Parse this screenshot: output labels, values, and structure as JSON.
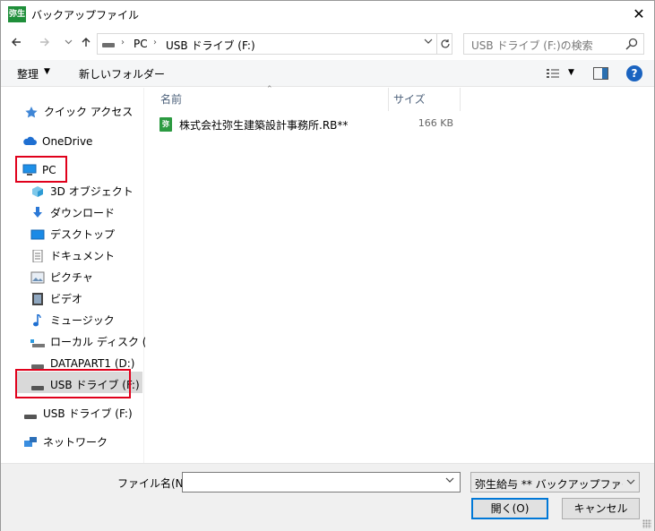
{
  "window": {
    "title": "バックアップファイル",
    "app_icon_text": "弥生",
    "close_glyph": "✕"
  },
  "address": {
    "segments": [
      "PC",
      "USB ドライブ (F:)"
    ],
    "search_placeholder": "USB ドライブ (F:)の検索"
  },
  "toolbar": {
    "organize": "整理",
    "new_folder": "新しいフォルダー",
    "help": "?"
  },
  "nav": {
    "items": [
      {
        "label": "クイック アクセス",
        "icon": "star-icon"
      },
      {
        "label": "OneDrive",
        "icon": "cloud-icon"
      },
      {
        "label": "PC",
        "icon": "pc-icon"
      },
      {
        "label": "3D オブジェクト",
        "icon": "cube-icon"
      },
      {
        "label": "ダウンロード",
        "icon": "download-icon"
      },
      {
        "label": "デスクトップ",
        "icon": "desktop-icon"
      },
      {
        "label": "ドキュメント",
        "icon": "document-icon"
      },
      {
        "label": "ピクチャ",
        "icon": "picture-icon"
      },
      {
        "label": "ビデオ",
        "icon": "video-icon"
      },
      {
        "label": "ミュージック",
        "icon": "music-icon"
      },
      {
        "label": "ローカル ディスク (C:)",
        "icon": "local-disk-icon"
      },
      {
        "label": "DATAPART1 (D:)",
        "icon": "drive-icon"
      },
      {
        "label": "USB ドライブ (F:)",
        "icon": "usb-drive-icon"
      },
      {
        "label": "USB ドライブ (F:)",
        "icon": "usb-drive-icon"
      },
      {
        "label": "ネットワーク",
        "icon": "network-icon"
      }
    ]
  },
  "files": {
    "columns": {
      "name": "名前",
      "size": "サイズ"
    },
    "rows": [
      {
        "name": "株式会社弥生建築設計事務所.RB**",
        "size": "166 KB",
        "icon_text": "弥"
      }
    ]
  },
  "bottom": {
    "filename_label": "ファイル名(N):",
    "filename_value": "",
    "filter_value": "弥生給与 ** バックアップファイル(*.",
    "open_label": "開く(O)",
    "cancel_label": "キャンセル"
  },
  "colors": {
    "highlight": "#e0001b",
    "selected_bg": "#d9d9d9",
    "accent": "#0078d7"
  }
}
